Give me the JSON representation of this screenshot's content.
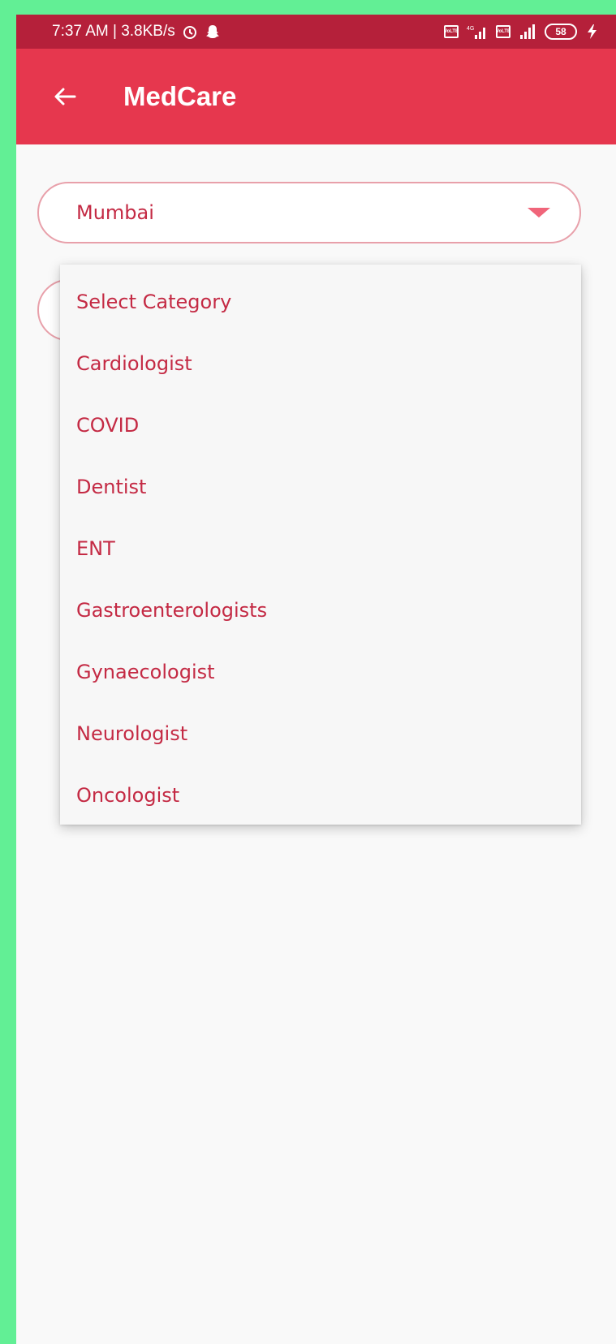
{
  "status_bar": {
    "time_speed": "7:37 AM | 3.8KB/s",
    "alarm_icon": "alarm-icon",
    "snapchat_icon": "snapchat-icon",
    "volte_label": "VoLTE",
    "network_4g": "4G",
    "battery": "58",
    "charging_icon": "charging-icon"
  },
  "app_bar": {
    "title": "MedCare",
    "back_icon": "back-arrow-icon"
  },
  "city_select": {
    "value": "Mumbai"
  },
  "category_menu": {
    "items": [
      "Select Category",
      "Cardiologist",
      "COVID",
      "Dentist",
      "ENT",
      "Gastroenterologists",
      "Gynaecologist",
      "Neurologist",
      "Oncologist"
    ]
  },
  "colors": {
    "primary": "#e6374e",
    "status_bar": "#b5203a",
    "text_accent": "#c42a44",
    "caret": "#f0657a"
  }
}
